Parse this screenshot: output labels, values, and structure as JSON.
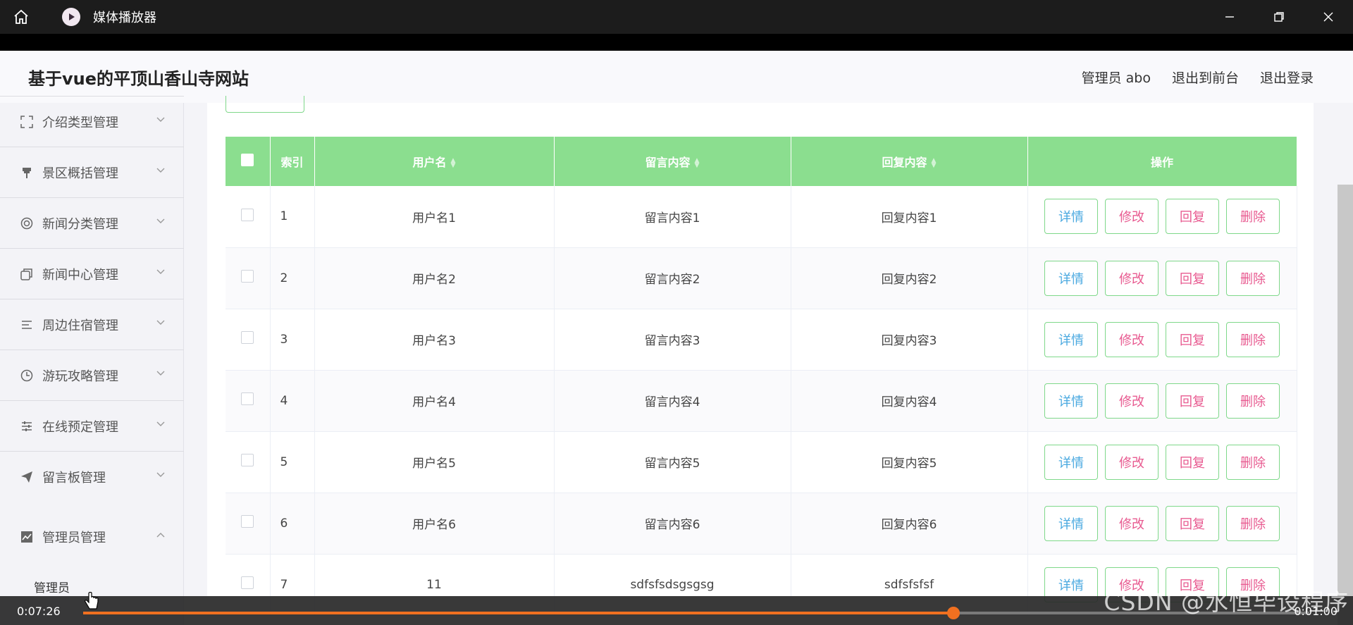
{
  "player": {
    "title": "媒体播放器",
    "current_time": "0:07:26",
    "total_time": "0:01:00",
    "progress": 0.71,
    "accent": "#f07020"
  },
  "header": {
    "site_title": "基于vue的平顶山香山寺网站",
    "admin_label": "管理员 abo",
    "to_front": "退出到前台",
    "logout": "退出登录"
  },
  "sidebar": {
    "items": [
      {
        "label": "介绍类型管理",
        "icon": "fullscreen-icon"
      },
      {
        "label": "景区概括管理",
        "icon": "pin-icon"
      },
      {
        "label": "新闻分类管理",
        "icon": "lifebuoy-icon"
      },
      {
        "label": "新闻中心管理",
        "icon": "copy-icon"
      },
      {
        "label": "周边住宿管理",
        "icon": "list-icon"
      },
      {
        "label": "游玩攻略管理",
        "icon": "clock-icon"
      },
      {
        "label": "在线预定管理",
        "icon": "sliders-icon"
      },
      {
        "label": "留言板管理",
        "icon": "paper-plane-icon"
      },
      {
        "label": "管理员管理",
        "icon": "chart-icon"
      }
    ],
    "submenu_label": "管理员"
  },
  "table": {
    "headers": {
      "index": "索引",
      "username": "用户名",
      "message": "留言内容",
      "reply": "回复内容",
      "actions": "操作"
    },
    "buttons": {
      "detail": "详情",
      "edit": "修改",
      "reply": "回复",
      "delete": "删除"
    },
    "rows": [
      {
        "index": "1",
        "username": "用户名1",
        "message": "留言内容1",
        "reply": "回复内容1"
      },
      {
        "index": "2",
        "username": "用户名2",
        "message": "留言内容2",
        "reply": "回复内容2"
      },
      {
        "index": "3",
        "username": "用户名3",
        "message": "留言内容3",
        "reply": "回复内容3"
      },
      {
        "index": "4",
        "username": "用户名4",
        "message": "留言内容4",
        "reply": "回复内容4"
      },
      {
        "index": "5",
        "username": "用户名5",
        "message": "留言内容5",
        "reply": "回复内容5"
      },
      {
        "index": "6",
        "username": "用户名6",
        "message": "留言内容6",
        "reply": "回复内容6"
      },
      {
        "index": "7",
        "username": "11",
        "message": "sdfsfsdsgsgsg",
        "reply": "sdfsfsfsf"
      }
    ],
    "header_color": "#8bde8f"
  },
  "watermark": "CSDN @水恒毕设程序"
}
